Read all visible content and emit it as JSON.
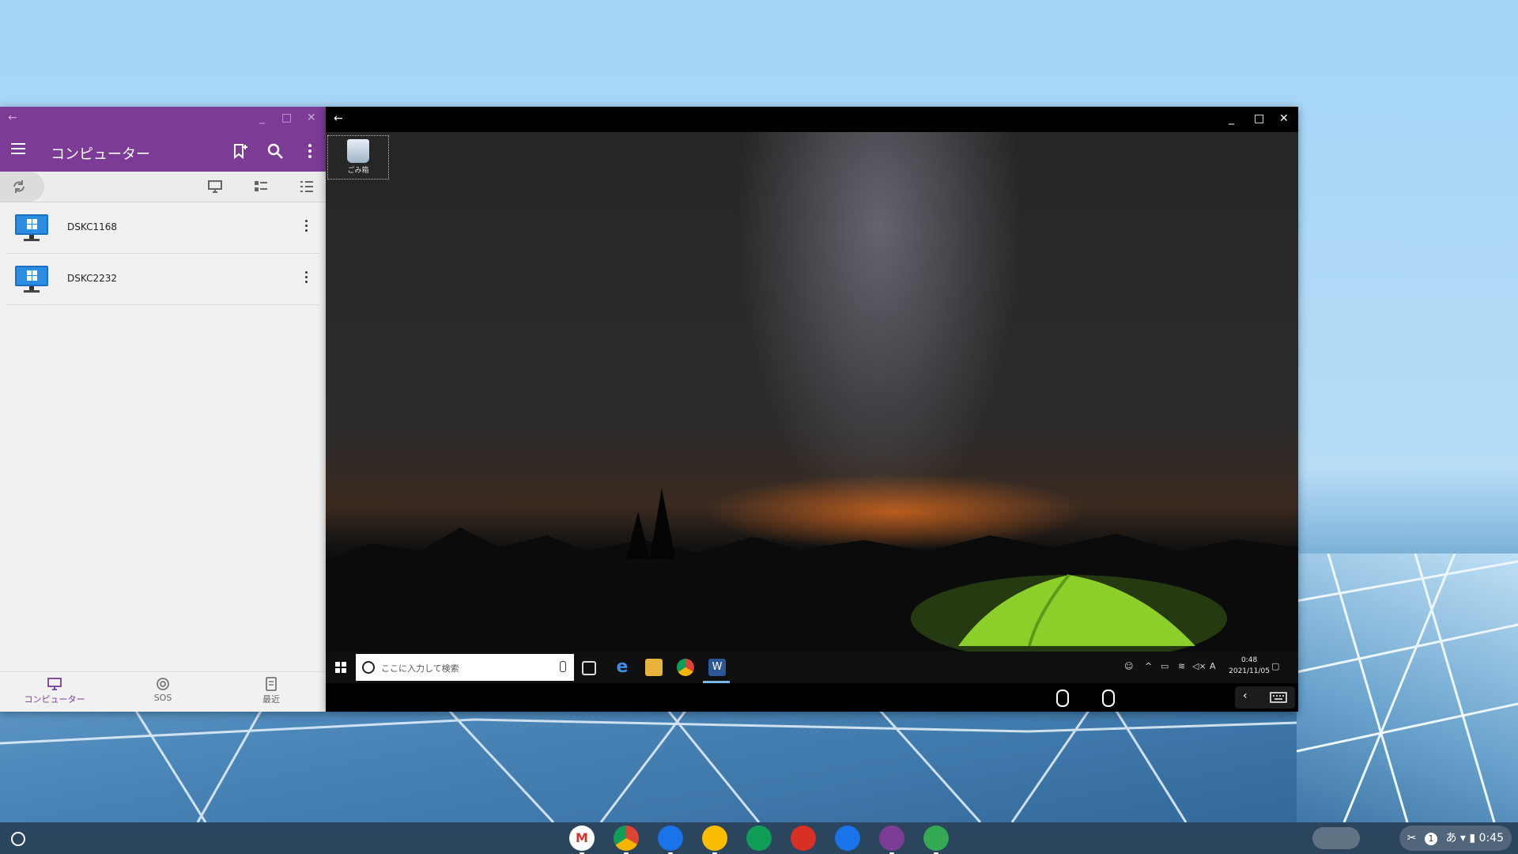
{
  "left_window": {
    "title": "コンピューター",
    "computers": [
      {
        "name": "DSKC1168"
      },
      {
        "name": "DSKC2232"
      }
    ],
    "bottom_nav": [
      {
        "label": "コンピューター"
      },
      {
        "label": "SOS"
      },
      {
        "label": "最近"
      }
    ]
  },
  "remote_window": {
    "desktop_icon": "ごみ箱",
    "taskbar": {
      "search_placeholder": "ここに入力して検索",
      "ime": "A",
      "time": "0:48",
      "date": "2021/11/05"
    }
  },
  "shelf": {
    "notification_count": "1",
    "ime": "あ",
    "time": "0:45"
  },
  "colors": {
    "accent": "#7c3c95",
    "desktop_tent": "#8ccf2a"
  }
}
